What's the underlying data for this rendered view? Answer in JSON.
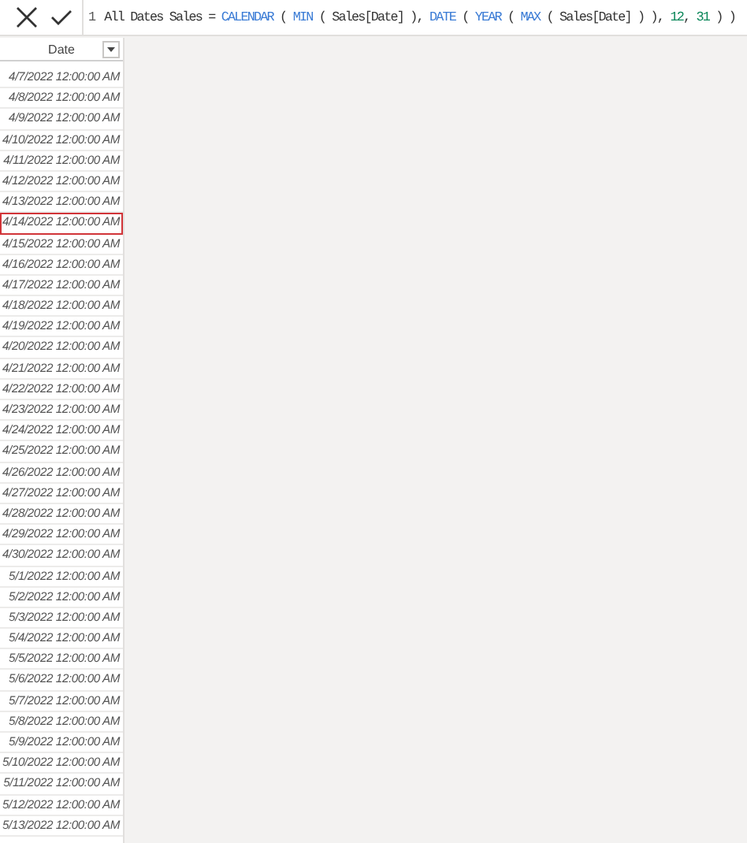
{
  "formula_bar": {
    "line_number": "1",
    "tokens": [
      {
        "kind": "plain",
        "text": "All Dates Sales = "
      },
      {
        "kind": "function",
        "text": "CALENDAR"
      },
      {
        "kind": "plain",
        "text": " ( "
      },
      {
        "kind": "function",
        "text": "MIN"
      },
      {
        "kind": "plain",
        "text": " ( Sales[Date] ), "
      },
      {
        "kind": "function",
        "text": "DATE"
      },
      {
        "kind": "plain",
        "text": " ( "
      },
      {
        "kind": "function",
        "text": "YEAR"
      },
      {
        "kind": "plain",
        "text": " ( "
      },
      {
        "kind": "function",
        "text": "MAX"
      },
      {
        "kind": "plain",
        "text": " ( Sales[Date] ) ), "
      },
      {
        "kind": "number",
        "text": "12"
      },
      {
        "kind": "plain",
        "text": ", "
      },
      {
        "kind": "number",
        "text": "31"
      },
      {
        "kind": "plain",
        "text": " ) )"
      }
    ]
  },
  "table": {
    "columns": [
      {
        "label": "Date"
      }
    ],
    "rows": [
      {
        "value": "4/7/2022 12:00:00 AM",
        "selected": false
      },
      {
        "value": "4/8/2022 12:00:00 AM",
        "selected": false
      },
      {
        "value": "4/9/2022 12:00:00 AM",
        "selected": false
      },
      {
        "value": "4/10/2022 12:00:00 AM",
        "selected": false
      },
      {
        "value": "4/11/2022 12:00:00 AM",
        "selected": false
      },
      {
        "value": "4/12/2022 12:00:00 AM",
        "selected": false
      },
      {
        "value": "4/13/2022 12:00:00 AM",
        "selected": false
      },
      {
        "value": "4/14/2022 12:00:00 AM",
        "selected": true
      },
      {
        "value": "4/15/2022 12:00:00 AM",
        "selected": false
      },
      {
        "value": "4/16/2022 12:00:00 AM",
        "selected": false
      },
      {
        "value": "4/17/2022 12:00:00 AM",
        "selected": false
      },
      {
        "value": "4/18/2022 12:00:00 AM",
        "selected": false
      },
      {
        "value": "4/19/2022 12:00:00 AM",
        "selected": false
      },
      {
        "value": "4/20/2022 12:00:00 AM",
        "selected": false
      },
      {
        "value": "4/21/2022 12:00:00 AM",
        "selected": false
      },
      {
        "value": "4/22/2022 12:00:00 AM",
        "selected": false
      },
      {
        "value": "4/23/2022 12:00:00 AM",
        "selected": false
      },
      {
        "value": "4/24/2022 12:00:00 AM",
        "selected": false
      },
      {
        "value": "4/25/2022 12:00:00 AM",
        "selected": false
      },
      {
        "value": "4/26/2022 12:00:00 AM",
        "selected": false
      },
      {
        "value": "4/27/2022 12:00:00 AM",
        "selected": false
      },
      {
        "value": "4/28/2022 12:00:00 AM",
        "selected": false
      },
      {
        "value": "4/29/2022 12:00:00 AM",
        "selected": false
      },
      {
        "value": "4/30/2022 12:00:00 AM",
        "selected": false
      },
      {
        "value": "5/1/2022 12:00:00 AM",
        "selected": false
      },
      {
        "value": "5/2/2022 12:00:00 AM",
        "selected": false
      },
      {
        "value": "5/3/2022 12:00:00 AM",
        "selected": false
      },
      {
        "value": "5/4/2022 12:00:00 AM",
        "selected": false
      },
      {
        "value": "5/5/2022 12:00:00 AM",
        "selected": false
      },
      {
        "value": "5/6/2022 12:00:00 AM",
        "selected": false
      },
      {
        "value": "5/7/2022 12:00:00 AM",
        "selected": false
      },
      {
        "value": "5/8/2022 12:00:00 AM",
        "selected": false
      },
      {
        "value": "5/9/2022 12:00:00 AM",
        "selected": false
      },
      {
        "value": "5/10/2022 12:00:00 AM",
        "selected": false
      },
      {
        "value": "5/11/2022 12:00:00 AM",
        "selected": false
      },
      {
        "value": "5/12/2022 12:00:00 AM",
        "selected": false
      },
      {
        "value": "5/13/2022 12:00:00 AM",
        "selected": false
      }
    ]
  }
}
